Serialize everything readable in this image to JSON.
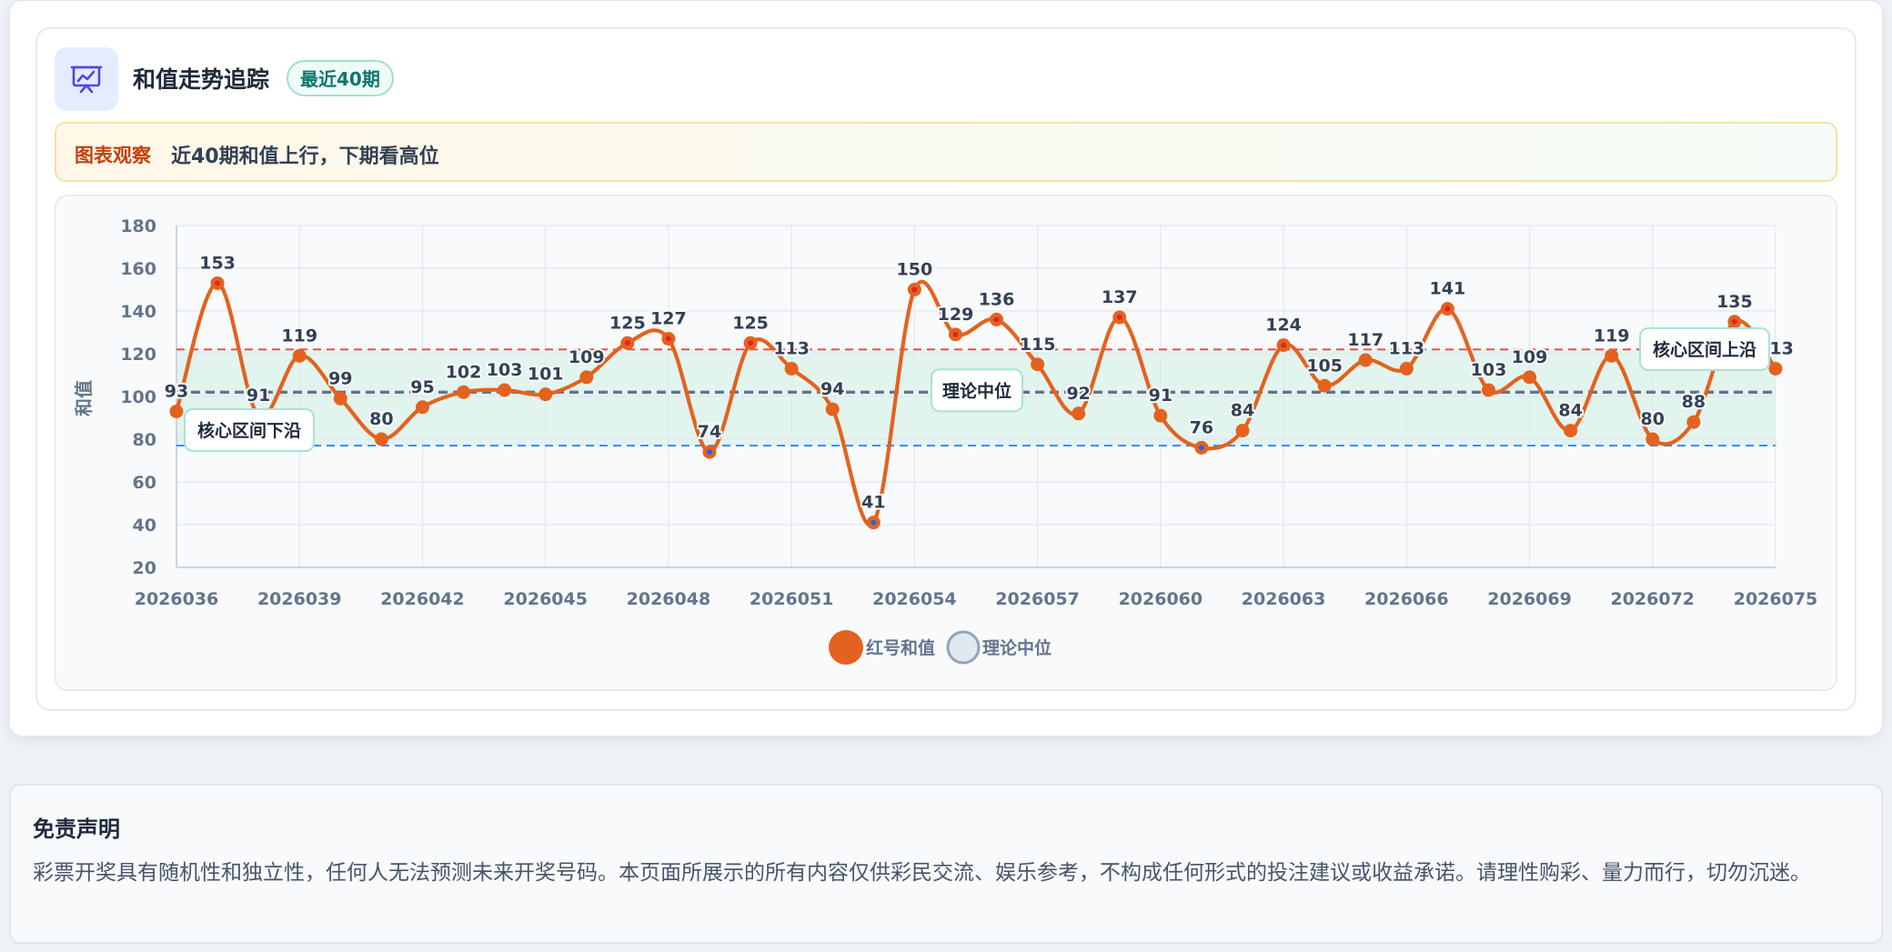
{
  "header": {
    "title": "和值走势追踪",
    "badge": "最近40期"
  },
  "insight": {
    "label": "图表观察",
    "text": "近40期和值上行，下期看高位"
  },
  "disclaimer": {
    "title": "免责声明",
    "text": "彩票开奖具有随机性和独立性，任何人无法预测未来开奖号码。本页面所展示的所有内容仅供彩民交流、娱乐参考，不构成任何形式的投注建议或收益承诺。请理性购彩、量力而行，切勿沉迷。"
  },
  "colors": {
    "line": "#e4621f",
    "band": "#d9f1ea",
    "upper_line": "#ef4444",
    "lower_line": "#3b82f6",
    "median_line": "#64748b",
    "point_inner_high": "#dc2626",
    "point_inner_low": "#2563eb"
  },
  "chart_data": {
    "type": "line",
    "ylabel": "和值",
    "ylim": [
      20,
      180
    ],
    "yticks": [
      20,
      40,
      60,
      80,
      100,
      120,
      140,
      160,
      180
    ],
    "x": [
      "2026036",
      "2026037",
      "2026038",
      "2026039",
      "2026040",
      "2026041",
      "2026042",
      "2026043",
      "2026044",
      "2026045",
      "2026046",
      "2026047",
      "2026048",
      "2026049",
      "2026050",
      "2026051",
      "2026052",
      "2026053",
      "2026054",
      "2026055",
      "2026056",
      "2026057",
      "2026058",
      "2026059",
      "2026060",
      "2026061",
      "2026062",
      "2026063",
      "2026064",
      "2026065",
      "2026066",
      "2026067",
      "2026068",
      "2026069",
      "2026070",
      "2026071",
      "2026072",
      "2026073",
      "2026074",
      "2026075"
    ],
    "xtick_labels": [
      "2026036",
      "2026039",
      "2026042",
      "2026045",
      "2026048",
      "2026051",
      "2026054",
      "2026057",
      "2026060",
      "2026063",
      "2026066",
      "2026069",
      "2026072",
      "2026075"
    ],
    "series": [
      {
        "name": "红号和值",
        "values": [
          93,
          153,
          91,
          119,
          99,
          80,
          95,
          102,
          103,
          101,
          109,
          125,
          127,
          74,
          125,
          113,
          94,
          41,
          150,
          129,
          136,
          115,
          92,
          137,
          91,
          76,
          84,
          124,
          105,
          117,
          113,
          141,
          103,
          109,
          84,
          119,
          80,
          88,
          135,
          113
        ]
      }
    ],
    "reference_lines": [
      {
        "name": "理论中位",
        "value": 102
      },
      {
        "name": "核心区间上沿",
        "value": 122
      },
      {
        "name": "核心区间下沿",
        "value": 77
      }
    ],
    "band": [
      77,
      122
    ],
    "legend": [
      "红号和值",
      "理论中位"
    ],
    "legend_position": "bottom",
    "grid": true
  }
}
